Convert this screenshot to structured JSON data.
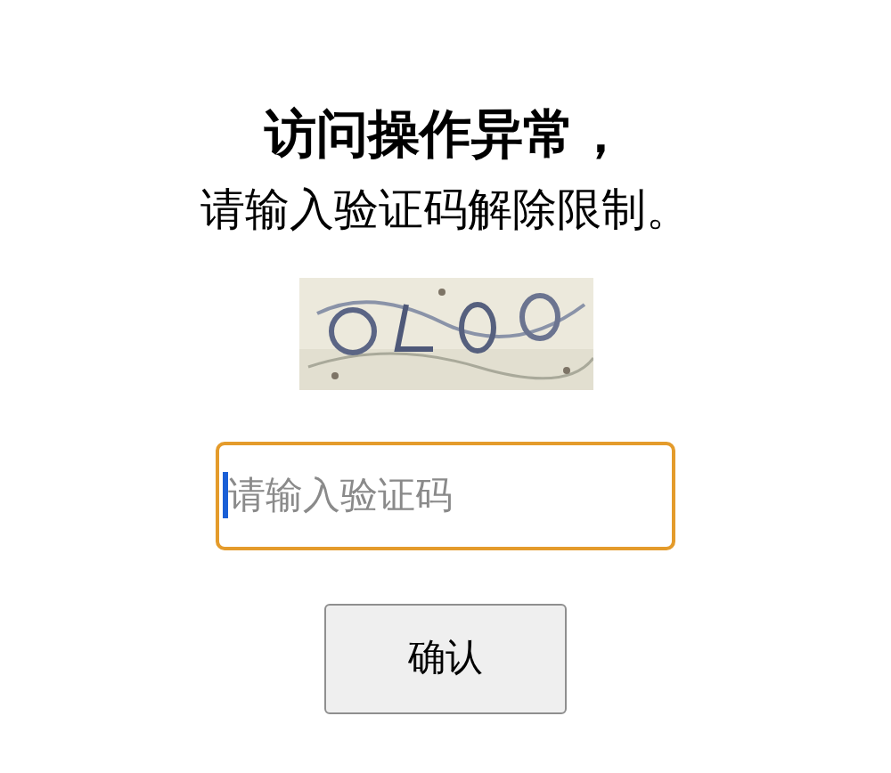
{
  "title": "访问操作异常，",
  "subtitle": "请输入验证码解除限制。",
  "input": {
    "placeholder": "请输入验证码",
    "focused": true
  },
  "button": {
    "label": "确认"
  }
}
